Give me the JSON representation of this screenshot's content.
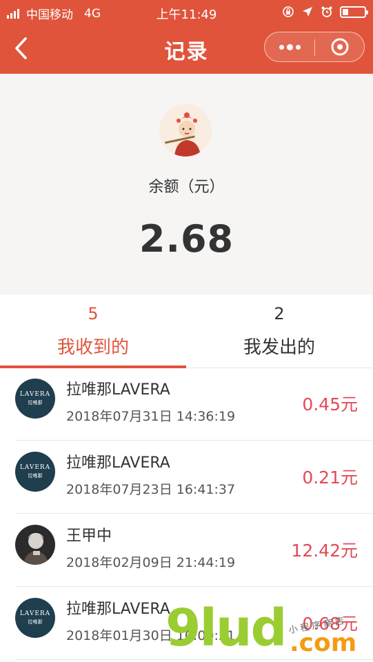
{
  "status_bar": {
    "carrier": "中国移动",
    "network": "4G",
    "time": "上午11:49"
  },
  "navbar": {
    "title": "记录"
  },
  "summary": {
    "balance_label": "余额（元）",
    "balance_value": "2.68"
  },
  "tabs": [
    {
      "count": "5",
      "label": "我收到的",
      "active": true
    },
    {
      "count": "2",
      "label": "我发出的",
      "active": false
    }
  ],
  "records": [
    {
      "name": "拉唯那LAVERA",
      "datetime": "2018年07月31日 14:36:19",
      "amount": "0.45元",
      "avatar": "lavera-logo",
      "avatar_text": "LAVERA",
      "avatar_sub": "拉唯那"
    },
    {
      "name": "拉唯那LAVERA",
      "datetime": "2018年07月23日 16:41:37",
      "amount": "0.21元",
      "avatar": "lavera-logo",
      "avatar_text": "LAVERA",
      "avatar_sub": "拉唯那"
    },
    {
      "name": "王甲中",
      "datetime": "2018年02月09日 21:44:19",
      "amount": "12.42元",
      "avatar": "person-photo"
    },
    {
      "name": "拉唯那LAVERA",
      "datetime": "2018年01月30日 10:00:51",
      "amount": "0.68元",
      "avatar": "lavera-logo",
      "avatar_text": "LAVERA",
      "avatar_sub": "拉唯那"
    }
  ],
  "watermark": {
    "main": "9lud",
    "suffix": ".com",
    "sub": "小程序商店"
  },
  "colors": {
    "brand_red": "#e0543b",
    "amount_red": "#e14a57",
    "lavera_blue": "#1f3e4e"
  }
}
